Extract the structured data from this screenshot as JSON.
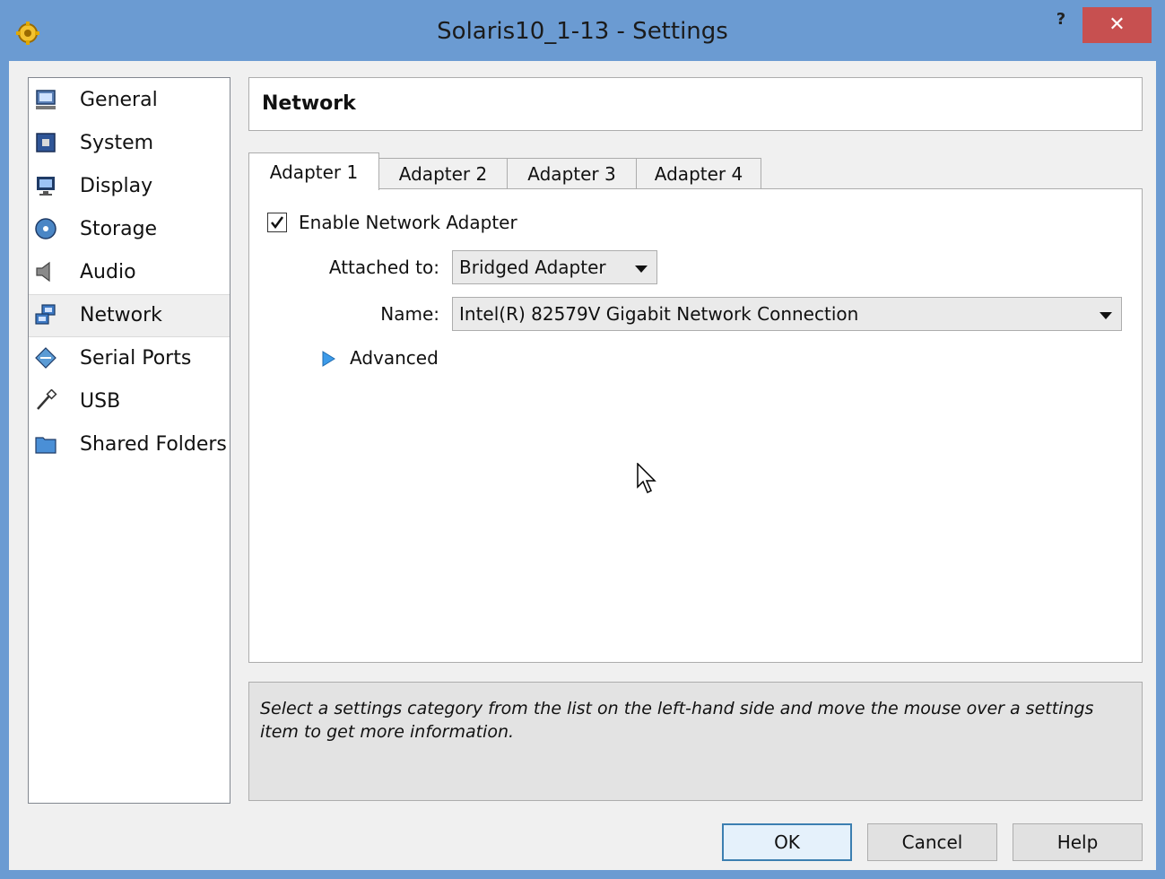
{
  "window": {
    "title": "Solaris10_1-13 - Settings",
    "help_label": "?",
    "close_label": "✕"
  },
  "sidebar": {
    "items": [
      {
        "label": "General",
        "icon": "general-icon"
      },
      {
        "label": "System",
        "icon": "system-icon"
      },
      {
        "label": "Display",
        "icon": "display-icon"
      },
      {
        "label": "Storage",
        "icon": "storage-icon"
      },
      {
        "label": "Audio",
        "icon": "audio-icon"
      },
      {
        "label": "Network",
        "icon": "network-icon",
        "selected": true
      },
      {
        "label": "Serial Ports",
        "icon": "serial-ports-icon"
      },
      {
        "label": "USB",
        "icon": "usb-icon"
      },
      {
        "label": "Shared Folders",
        "icon": "shared-folders-icon"
      }
    ]
  },
  "page": {
    "title": "Network"
  },
  "tabs": [
    {
      "label": "Adapter 1",
      "active": true
    },
    {
      "label": "Adapter 2"
    },
    {
      "label": "Adapter 3"
    },
    {
      "label": "Adapter 4"
    }
  ],
  "adapter": {
    "enable_label": "Enable Network Adapter",
    "enabled": true,
    "attached_label": "Attached to:",
    "attached_value": "Bridged Adapter",
    "name_label": "Name:",
    "name_value": "Intel(R) 82579V Gigabit Network Connection",
    "advanced_label": "Advanced"
  },
  "info": {
    "text": "Select a settings category from the list on the left-hand side and move the mouse over a settings item to get more information."
  },
  "buttons": {
    "ok": "OK",
    "cancel": "Cancel",
    "help": "Help"
  },
  "colors": {
    "titlebar": "#6b9bd2",
    "close": "#c75050",
    "accent": "#3c7fb1"
  }
}
